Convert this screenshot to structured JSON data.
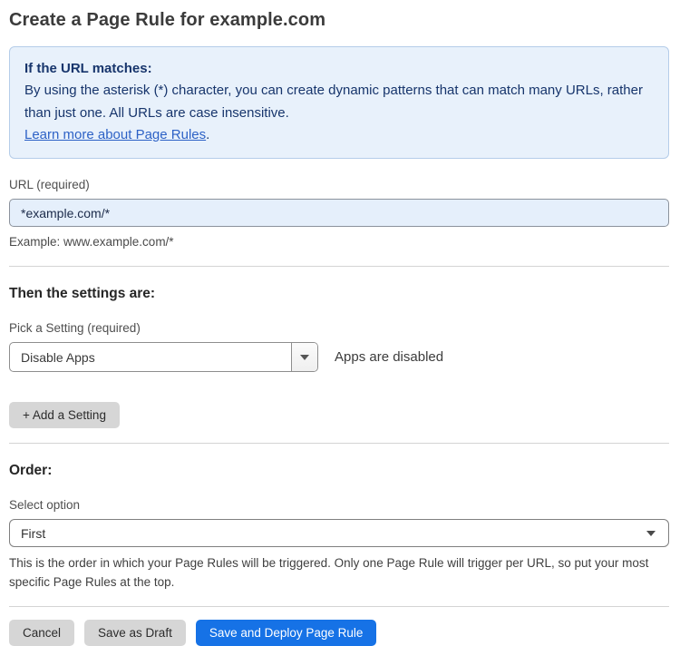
{
  "page": {
    "title": "Create a Page Rule for example.com"
  },
  "info_box": {
    "heading": "If the URL matches:",
    "body": "By using the asterisk (*) character, you can create dynamic patterns that can match many URLs, rather than just one. All URLs are case insensitive.",
    "link_label": "Learn more about Page Rules",
    "link_suffix": "."
  },
  "url_field": {
    "label": "URL (required)",
    "value": "*example.com/*",
    "helper": "Example: www.example.com/*"
  },
  "settings_section": {
    "heading": "Then the settings are:",
    "picker_label": "Pick a Setting (required)",
    "selected_setting": "Disable Apps",
    "status_text": "Apps are disabled",
    "add_setting_label": "+ Add a Setting"
  },
  "order_section": {
    "heading": "Order:",
    "select_label": "Select option",
    "selected_option": "First",
    "helper": "This is the order in which your Page Rules will be triggered. Only one Page Rule will trigger per URL, so put your most specific Page Rules at the top."
  },
  "footer": {
    "cancel_label": "Cancel",
    "save_draft_label": "Save as Draft",
    "save_deploy_label": "Save and Deploy Page Rule"
  },
  "icons": {
    "caret_down": "caret-down-icon"
  },
  "colors": {
    "primary_button": "#1672e6",
    "info_box_bg": "#e8f1fb",
    "info_box_border": "#b5cde9",
    "info_text": "#17356c",
    "link": "#2d62c6",
    "input_bg": "#e5effb",
    "gray_button": "#d6d6d6"
  }
}
